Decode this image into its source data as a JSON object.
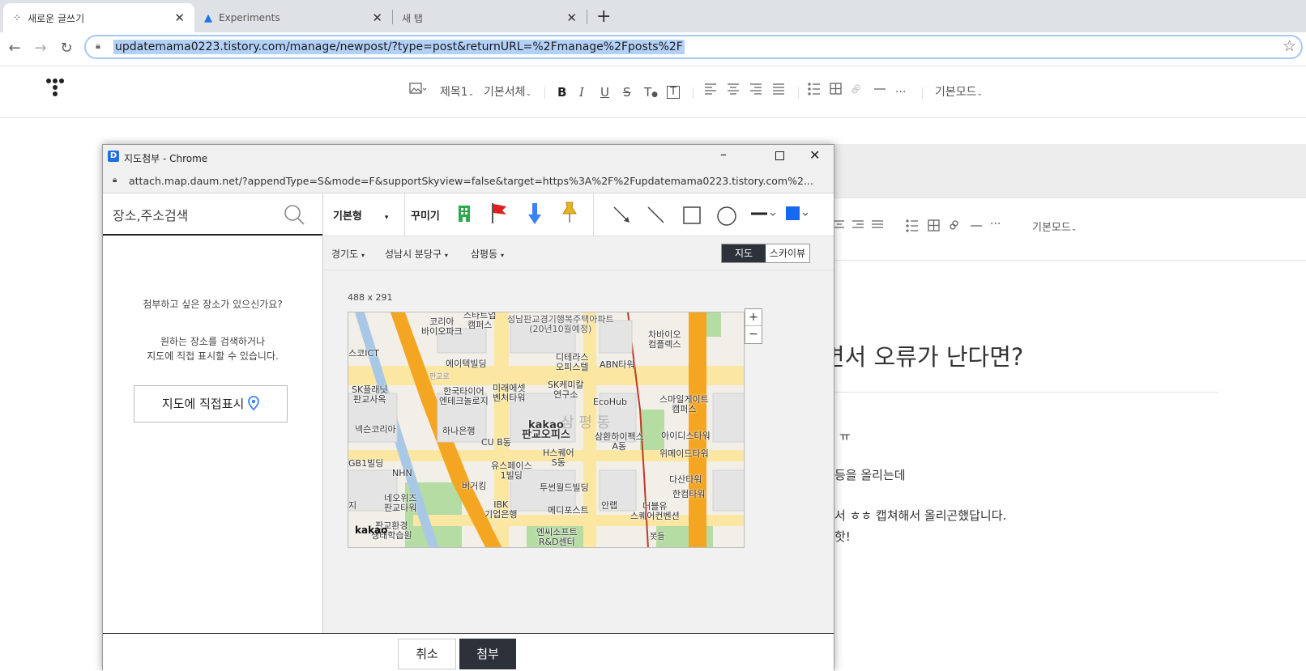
{
  "browser": {
    "tabs": [
      {
        "title": "새로운 글쓰기"
      },
      {
        "title": "Experiments"
      },
      {
        "title": "새 탭"
      }
    ],
    "close_glyph": "✕",
    "new_tab_glyph": "+",
    "url": "updatemama0223.tistory.com/manage/newpost/?type=post&returnURL=%2Fmanage%2Fposts%2F"
  },
  "editor_toolbar": {
    "heading": "제목1",
    "font": "기본서체",
    "bold": "B",
    "italic": "I",
    "underline": "U",
    "strike": "S",
    "text_color": "T",
    "text_bg": "T",
    "more": "···",
    "mode": "기본모드"
  },
  "background_editor": {
    "toolbar_more": "···",
    "toolbar_mode": "기본모드",
    "title_fragment": "면서 오류가 난다면?",
    "line1": "ㅠ",
    "line2": "등을 올리는데",
    "line3": "서 ㅎㅎ 캡쳐해서 올리곤했답니다.",
    "line4": "핫!"
  },
  "popup": {
    "window_title": "지도첨부 - Chrome",
    "url": "attach.map.daum.net/?appendType=S&mode=F&supportSkyview=false&target=https%3A%2F%2Fupdatemama0223.tistory.com%2...",
    "search_placeholder": "장소,주소검색",
    "prompt_q": "첨부하고 싶은 장소가 있으신가요?",
    "prompt_line1": "원하는 장소를 검색하거나",
    "prompt_line2": "지도에 직접 표시할 수 있습니다.",
    "direct_mark_button": "지도에 직접표시",
    "style_select": "기본형",
    "decorate_label": "꾸미기",
    "region": {
      "province": "경기도",
      "district": "성남시 분당구",
      "dong": "삼평동"
    },
    "view_map": "지도",
    "view_sky": "스카이뷰",
    "map_size": "488 x 291",
    "zoom_in": "+",
    "zoom_out": "−",
    "map_logo": "kakao",
    "map_labels": [
      "코리아\n바이오파크",
      "스타트업\n캠퍼스",
      "성남판교경기행복주택아파트\n(20년10월예정)",
      "차바이오\n컴플렉스",
      "스코ICT",
      "에이텍빌딩",
      "디테라스\n오피스텔",
      "ABN타워",
      "SK플래닛\n판교사옥",
      "한국타이어\n엔테크놀로지",
      "미래에셋\n벤처타워",
      "SK케미칼\n연구소",
      "EcoHub",
      "스마일게이트\n캠퍼스",
      "넥슨코리아",
      "하나은행",
      "kakao\n판교오피스",
      "CU B동",
      "삼환하이펙스\nA동",
      "아이디스타워",
      "위메이드타워",
      "GB1빌딩",
      "NHN",
      "유스페이스\n1빌딩",
      "H스퀘어\nS동",
      "버거킹",
      "투썬월드빌딩",
      "다산타워",
      "한컴타워",
      "네오위즈\n판교타워",
      "IBK\n기업은행",
      "메디포스트",
      "안랩",
      "더블유\n스퀘어컨벤션",
      "판교환경\n생태학습원",
      "엔씨소프트\nR&D센터",
      "지",
      "판교로",
      "봇들",
      "삼 평 동"
    ],
    "cancel_button": "취소",
    "attach_button": "첨부"
  },
  "colors": {
    "accent": "#2d323a",
    "map_road_main": "#f4a623",
    "map_road_minor": "#fbe7a1",
    "map_green": "#b5dca3",
    "map_building": "#e8e8e8",
    "map_subway": "#c0392b",
    "pin_blue": "#3b82f6",
    "flag_red": "#e02020",
    "building_icon_green": "#2fa84f",
    "bell_yellow": "#e6b422",
    "fill_color": "#1668f0"
  }
}
